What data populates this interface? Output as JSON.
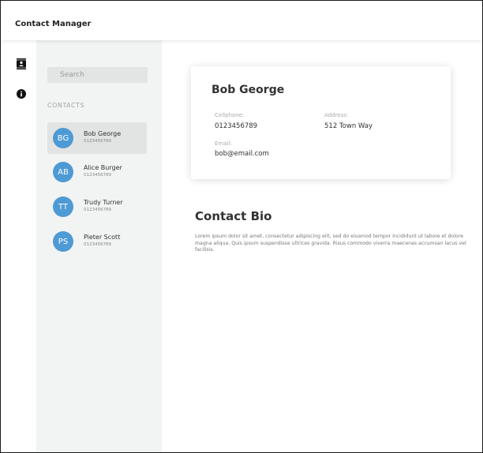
{
  "app": {
    "title": "Contact Manager"
  },
  "rail": {
    "icons": [
      "contacts-icon",
      "info-icon"
    ]
  },
  "sidebar": {
    "search_placeholder": "Search",
    "section_label": "CONTACTS",
    "contacts": [
      {
        "initials": "BG",
        "name": "Bob George",
        "phone": "0123456789",
        "selected": true
      },
      {
        "initials": "AB",
        "name": "Alice Burger",
        "phone": "0123456789",
        "selected": false
      },
      {
        "initials": "TT",
        "name": "Trudy Turner",
        "phone": "0123456789",
        "selected": false
      },
      {
        "initials": "PS",
        "name": "Pieter Scott",
        "phone": "0123456789",
        "selected": false
      }
    ]
  },
  "detail": {
    "name": "Bob George",
    "cellphone_label": "Cellphone:",
    "cellphone": "0123456789",
    "address_label": "Address:",
    "address": "512 Town Way",
    "email_label": "Email:",
    "email": "bob@email.com",
    "bio_title": "Contact Bio",
    "bio": "Lorem ipsum dolor sit amet, consectetur adipiscing elit, sed do eiusmod tempor incididunt ut labore et dolore magna aliqua. Quis ipsum suspendisse ultrices gravida. Risus commodo viverra maecenas accumsan lacus vel facilisis."
  },
  "colors": {
    "avatar": "#4e9ad5",
    "panel": "#f2f3f3",
    "selected": "#e2e3e3"
  }
}
